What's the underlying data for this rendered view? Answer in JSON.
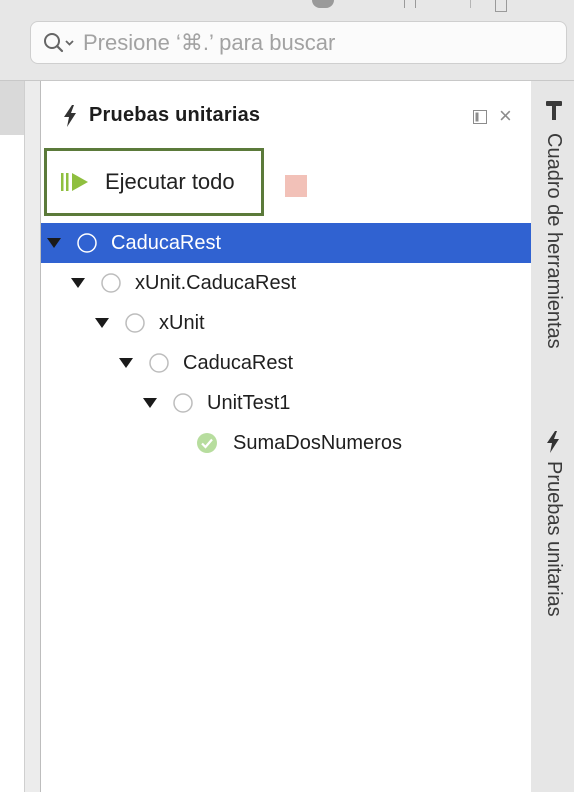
{
  "search": {
    "placeholder": "Presione ‘⌘.’ para buscar"
  },
  "pad": {
    "title": "Pruebas unitarias",
    "title_icon": "lightning-icon",
    "dock_icon": "dock-toggle-icon",
    "close_icon": "close-icon",
    "close_glyph": "×",
    "run_all_label": "Ejecutar todo",
    "run_all_icon": "run-all-icon",
    "stop_icon": "stop-icon",
    "stop_color": "#f2c1b8"
  },
  "tree": {
    "rows": [
      {
        "label": "CaducaRest",
        "level": 0,
        "expanded": true,
        "status": "not-run",
        "selected": true
      },
      {
        "label": "xUnit.CaducaRest",
        "level": 1,
        "expanded": true,
        "status": "not-run",
        "selected": false
      },
      {
        "label": "xUnit",
        "level": 2,
        "expanded": true,
        "status": "not-run",
        "selected": false
      },
      {
        "label": "CaducaRest",
        "level": 3,
        "expanded": true,
        "status": "not-run",
        "selected": false
      },
      {
        "label": "UnitTest1",
        "level": 4,
        "expanded": true,
        "status": "not-run",
        "selected": false
      },
      {
        "label": "SumaDosNumeros",
        "level": 5,
        "expanded": false,
        "status": "passed",
        "selected": false
      }
    ]
  },
  "dock_tabs": [
    {
      "label": "Cuadro de herramientas",
      "icon": "hammer-icon"
    },
    {
      "label": "Pruebas unitarias",
      "icon": "lightning-icon"
    }
  ],
  "colors": {
    "selection": "#3062d1",
    "run_all_border": "#5b7a3a",
    "run_icon": "#8fbf3f",
    "passed": "#b7dd9e"
  }
}
